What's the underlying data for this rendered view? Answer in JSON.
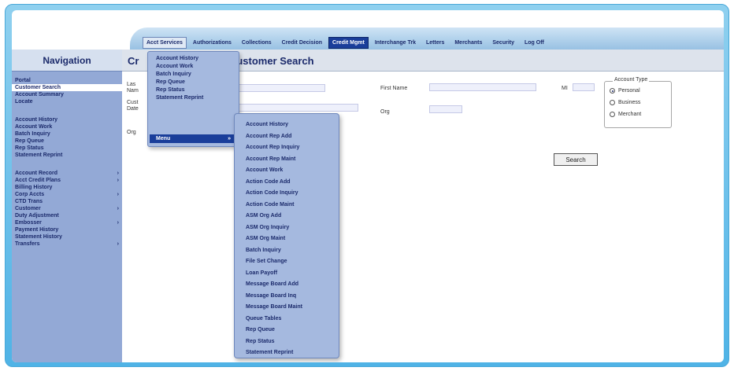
{
  "top_menu": [
    {
      "label": "Acct Services",
      "state": "open"
    },
    {
      "label": "Authorizations",
      "state": ""
    },
    {
      "label": "Collections",
      "state": ""
    },
    {
      "label": "Credit Decision",
      "state": ""
    },
    {
      "label": "Credit Mgmt",
      "state": "selected"
    },
    {
      "label": "Interchange Trk",
      "state": ""
    },
    {
      "label": "Letters",
      "state": ""
    },
    {
      "label": "Merchants",
      "state": ""
    },
    {
      "label": "Security",
      "state": ""
    },
    {
      "label": "Log Off",
      "state": ""
    }
  ],
  "sidebar": {
    "title": "Navigation",
    "groups": [
      [
        {
          "label": "Portal",
          "arrow": ""
        },
        {
          "label": "Customer Search",
          "arrow": "",
          "active": true
        },
        {
          "label": "Account Summary",
          "arrow": ""
        },
        {
          "label": "Locate",
          "arrow": ""
        }
      ],
      [
        {
          "label": "Account History",
          "arrow": ""
        },
        {
          "label": "Account Work",
          "arrow": ""
        },
        {
          "label": "Batch Inquiry",
          "arrow": ""
        },
        {
          "label": "Rep Queue",
          "arrow": ""
        },
        {
          "label": "Rep Status",
          "arrow": ""
        },
        {
          "label": "Statement Reprint",
          "arrow": ""
        }
      ],
      [
        {
          "label": "Account Record",
          "arrow": "›"
        },
        {
          "label": "Acct Credit Plans",
          "arrow": "›"
        },
        {
          "label": "Billing History",
          "arrow": ""
        },
        {
          "label": "Corp Accts",
          "arrow": "›"
        },
        {
          "label": "CTD Trans",
          "arrow": ""
        },
        {
          "label": "Customer",
          "arrow": "›"
        },
        {
          "label": "Duty Adjustment",
          "arrow": ""
        },
        {
          "label": "Embosser",
          "arrow": "›"
        },
        {
          "label": "Payment History",
          "arrow": ""
        },
        {
          "label": "Statement History",
          "arrow": ""
        },
        {
          "label": "Transfers",
          "arrow": "›"
        }
      ]
    ]
  },
  "page": {
    "title_prefix": "Cr",
    "title_suffix": "t Customer Search"
  },
  "form": {
    "lbl_last_1": "Las",
    "lbl_last_2": "Nam",
    "lbl_cust_1": "Cust",
    "lbl_cust_2": "Date",
    "lbl_org_left": "Org",
    "first_name_label": "First Name",
    "first_name_value": "",
    "mi_label": "MI",
    "mi_value": "",
    "org_label": "Org",
    "org_value": "",
    "account_type_legend": "Account Type",
    "account_types": [
      {
        "label": "Personal",
        "selected": true
      },
      {
        "label": "Business",
        "selected": false
      },
      {
        "label": "Merchant",
        "selected": false
      }
    ],
    "search_button": "Search"
  },
  "dropdown": {
    "items": [
      "Account History",
      "Account Work",
      "Batch Inquiry",
      "Rep Queue",
      "Rep Status",
      "Statement Reprint"
    ],
    "menu_label": "Menu",
    "menu_arrow": "»"
  },
  "submenu": {
    "items": [
      "Account History",
      "Account Rep Add",
      "Account Rep Inquiry",
      "Account Rep Maint",
      "Account Work",
      "Action Code Add",
      "Action Code Inquiry",
      "Action Code Maint",
      "ASM Org Add",
      "ASM Org Inquiry",
      "ASM Org Maint",
      "Batch Inquiry",
      "File Set Change",
      "Loan Payoff",
      "Message Board Add",
      "Message Board Inq",
      "Message Board Maint",
      "Queue Tables",
      "Rep Queue",
      "Rep Status",
      "Statement Reprint"
    ]
  },
  "colors": {
    "frame": "#4fb3e6",
    "sidebar": "#93a9d6",
    "selected_tab": "#1a3e9a",
    "text_navy": "#1b2a6b"
  }
}
